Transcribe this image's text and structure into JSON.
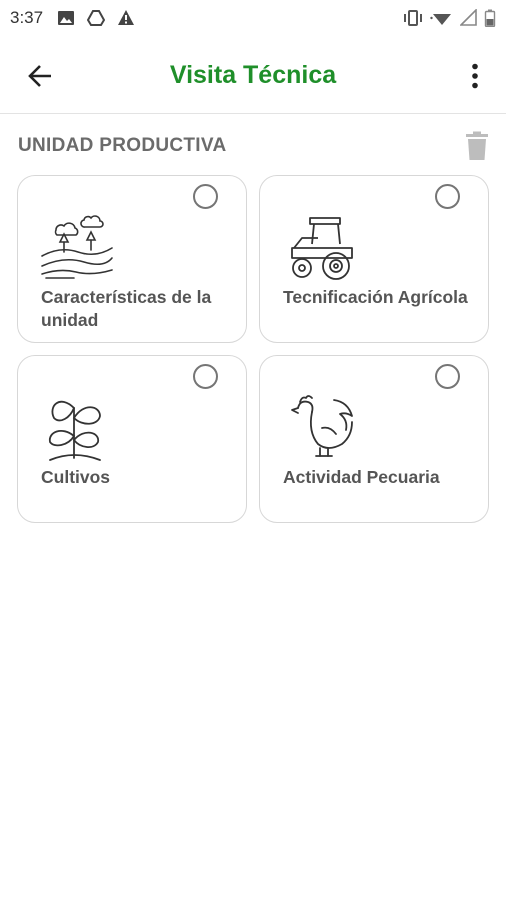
{
  "status_bar": {
    "time": "3:37",
    "left_icons": [
      "image-icon",
      "drive-icon",
      "warning-icon"
    ],
    "right_icons": [
      "vibrate-icon",
      "wifi-icon",
      "signal-icon",
      "battery-icon"
    ]
  },
  "app_bar": {
    "title": "Visita Técnica",
    "back_icon": "arrow-left-icon",
    "menu_icon": "more-vert-icon",
    "title_color": "#1f8f2a"
  },
  "section": {
    "title": "UNIDAD PRODUCTIVA",
    "delete_icon": "trash-icon"
  },
  "cards": [
    {
      "label": "Características de la unidad",
      "icon": "landscape-icon",
      "selected": false
    },
    {
      "label": "Tecnificación Agrícola",
      "icon": "tractor-icon",
      "selected": false
    },
    {
      "label": "Cultivos",
      "icon": "sprout-icon",
      "selected": false
    },
    {
      "label": "Actividad Pecuaria",
      "icon": "rooster-icon",
      "selected": false
    }
  ]
}
